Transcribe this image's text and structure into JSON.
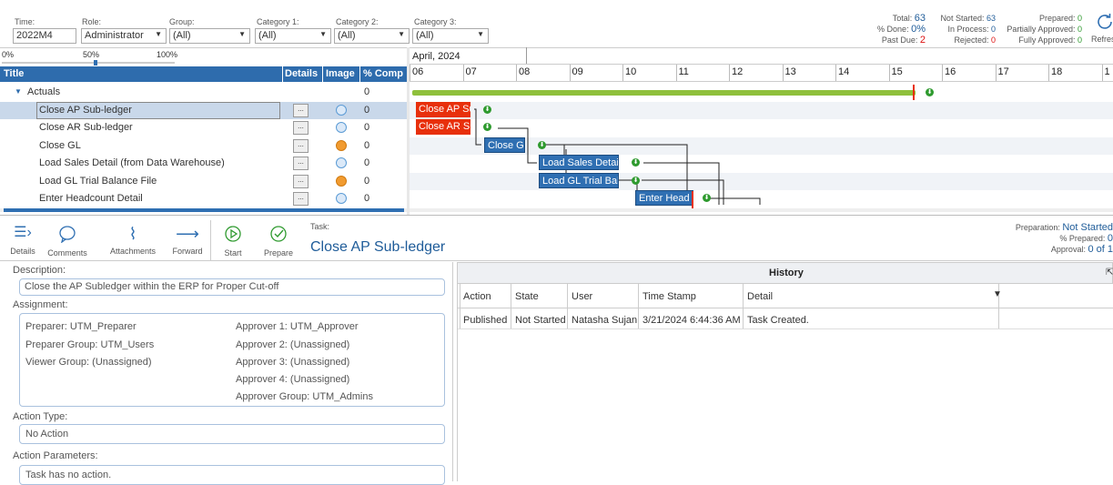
{
  "filters": {
    "time": {
      "label": "Time:",
      "value": "2022M4"
    },
    "role": {
      "label": "Role:",
      "value": "Administrator"
    },
    "group": {
      "label": "Group:",
      "value": "(All)"
    },
    "category1": {
      "label": "Category 1:",
      "value": "(All)"
    },
    "category2": {
      "label": "Category 2:",
      "value": "(All)"
    },
    "category3": {
      "label": "Category 3:",
      "value": "(All)"
    }
  },
  "stats": {
    "total_label": "Total:",
    "total": "63",
    "done_label": "% Done:",
    "done": "0%",
    "pastdue_label": "Past Due:",
    "pastdue": "2",
    "notstarted_label": "Not Started:",
    "notstarted": "63",
    "inprocess_label": "In Process:",
    "inprocess": "0",
    "rejected_label": "Rejected:",
    "rejected": "0",
    "prepared_label": "Prepared:",
    "prepared": "0",
    "partial_label": "Partially Approved:",
    "partial": "0",
    "full_label": "Fully Approved:",
    "full": "0",
    "refresh_label": "Refresh"
  },
  "zoom": {
    "min": "0%",
    "mid": "50%",
    "max": "100%",
    "level": 0.55
  },
  "grid": {
    "headers": {
      "title": "Title",
      "details": "Details",
      "image": "Image",
      "pct": "% Comp"
    },
    "group": "Actuals",
    "group_pct": "0",
    "rows": [
      {
        "title": "Close AP Sub-ledger",
        "pct": "0",
        "status": "blue"
      },
      {
        "title": "Close AR Sub-ledger",
        "pct": "0",
        "status": "blue"
      },
      {
        "title": "Close GL",
        "pct": "0",
        "status": "orange"
      },
      {
        "title": "Load Sales Detail (from Data Warehouse)",
        "pct": "0",
        "status": "blue"
      },
      {
        "title": "Load GL Trial Balance File",
        "pct": "0",
        "status": "orange"
      },
      {
        "title": "Enter Headcount Detail",
        "pct": "0",
        "status": "blue"
      }
    ],
    "details_btn": "..."
  },
  "gantt": {
    "month": "April, 2024",
    "days": [
      "06",
      "07",
      "08",
      "09",
      "10",
      "11",
      "12",
      "13",
      "14",
      "15",
      "16",
      "17",
      "18",
      "1"
    ],
    "bars": [
      "Close AP Sub-ledger",
      "Close AR Sub-ledger",
      "Close G",
      "Load Sales Detail",
      "Load GL Trial Bala",
      "Enter Head"
    ]
  },
  "toolbar": {
    "details": "Details",
    "comments": "Comments",
    "attachments": "Attachments",
    "forward": "Forward",
    "start": "Start",
    "prepare": "Prepare"
  },
  "task": {
    "label": "Task:",
    "name": "Close AP Sub-ledger"
  },
  "prep": {
    "prep_label": "Preparation:",
    "prep": "Not Started",
    "pctprep_label": "% Prepared:",
    "pctprep": "0",
    "approval_label": "Approval:",
    "approval": "0 of 1"
  },
  "form": {
    "description_label": "Description:",
    "description": "Close the AP Subledger within the ERP for Proper Cut-off",
    "assignment_label": "Assignment:",
    "preparer": "Preparer: UTM_Preparer",
    "preparer_group": "Preparer Group: UTM_Users",
    "viewer_group": "Viewer Group: (Unassigned)",
    "approver1": "Approver 1: UTM_Approver",
    "approver2": "Approver 2: (Unassigned)",
    "approver3": "Approver 3: (Unassigned)",
    "approver4": "Approver 4: (Unassigned)",
    "approver_group": "Approver Group: UTM_Admins",
    "action_type_label": "Action Type:",
    "action_type": "No Action",
    "action_params_label": "Action Parameters:",
    "action_params": "Task has no action."
  },
  "history": {
    "title": "History",
    "columns": [
      "Action",
      "State",
      "User",
      "Time Stamp",
      "Detail"
    ],
    "rows": [
      {
        "action": "Published",
        "state": "Not Started",
        "user": "Natasha Sujan",
        "timestamp": "3/21/2024 6:44:36 AM",
        "detail": "Task Created."
      }
    ]
  }
}
